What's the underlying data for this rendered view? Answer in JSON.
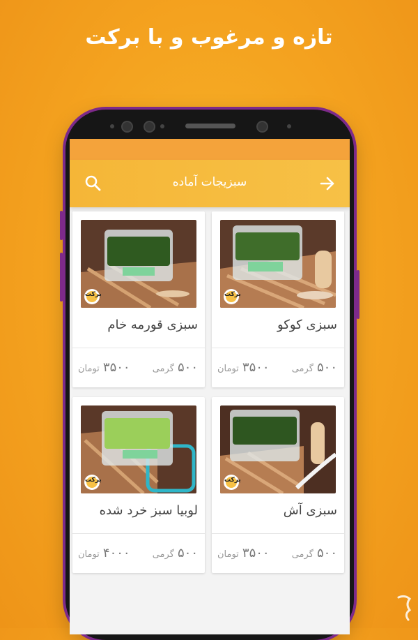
{
  "promo": {
    "title": "تازه و مرغوب و با برکت"
  },
  "appbar": {
    "title": "سبزیجات آماده",
    "search_icon": "search-icon",
    "back_icon": "arrow-right-icon"
  },
  "products": [
    {
      "name": "سبزی کوکو",
      "weight_value": "۵۰۰",
      "weight_unit": "گرمی",
      "price": "۳۵۰۰",
      "currency": "تومان"
    },
    {
      "name": "سبزی قورمه خام",
      "weight_value": "۵۰۰",
      "weight_unit": "گرمی",
      "price": "۳۵۰۰",
      "currency": "تومان"
    },
    {
      "name": "سبزی آش",
      "weight_value": "۵۰۰",
      "weight_unit": "گرمی",
      "price": "۳۵۰۰",
      "currency": "تومان"
    },
    {
      "name": "لوبیا سبز خرد شده",
      "weight_value": "۵۰۰",
      "weight_unit": "گرمی",
      "price": "۴۰۰۰",
      "currency": "تومان"
    }
  ],
  "brand": {
    "badge_text": "برکت"
  },
  "colors": {
    "accent": "#f5b637",
    "background": "#f4a21f",
    "frame": "#7d2a8a"
  }
}
